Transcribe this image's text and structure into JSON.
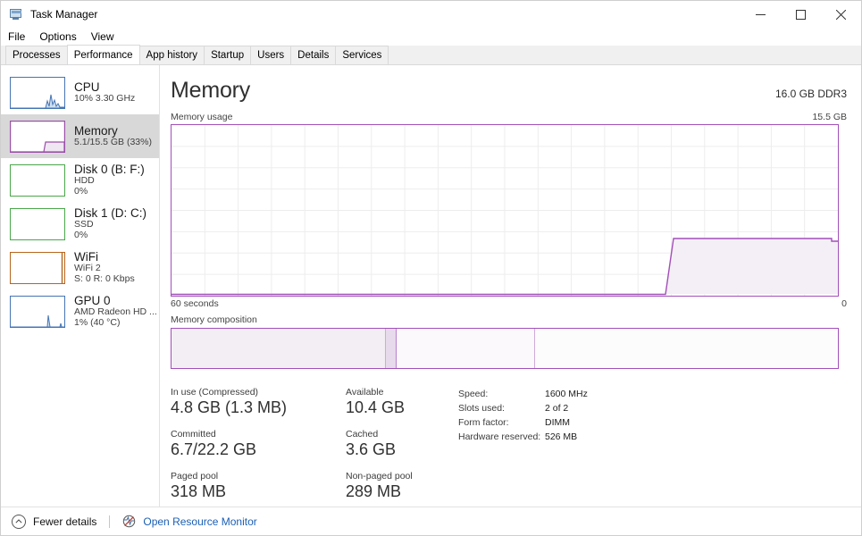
{
  "window": {
    "title": "Task Manager",
    "icon": "task-manager-icon",
    "minimize": "–",
    "maximize": "□",
    "close": "✕"
  },
  "menu": [
    "File",
    "Options",
    "View"
  ],
  "tabs": [
    {
      "label": "Processes",
      "active": false
    },
    {
      "label": "Performance",
      "active": true
    },
    {
      "label": "App history",
      "active": false
    },
    {
      "label": "Startup",
      "active": false
    },
    {
      "label": "Users",
      "active": false
    },
    {
      "label": "Details",
      "active": false
    },
    {
      "label": "Services",
      "active": false
    }
  ],
  "sidebar": {
    "items": [
      {
        "title": "CPU",
        "sub1": "10%  3.30 GHz",
        "sub2": "",
        "color": "#4575b4",
        "selected": false
      },
      {
        "title": "Memory",
        "sub1": "5.1/15.5 GB (33%)",
        "sub2": "",
        "color": "#9a4fa8",
        "selected": true
      },
      {
        "title": "Disk 0 (B: F:)",
        "sub1": "HDD",
        "sub2": "0%",
        "color": "#4aa64a",
        "selected": false
      },
      {
        "title": "Disk 1 (D: C:)",
        "sub1": "SSD",
        "sub2": "0%",
        "color": "#4aa64a",
        "selected": false
      },
      {
        "title": "WiFi",
        "sub1": "WiFi 2",
        "sub2": "S: 0 R: 0 Kbps",
        "color": "#b5651d",
        "selected": false
      },
      {
        "title": "GPU 0",
        "sub1": "AMD Radeon HD ...",
        "sub2": "1%  (40 °C)",
        "color": "#4575b4",
        "selected": false
      }
    ]
  },
  "main": {
    "title": "Memory",
    "capacity": "16.0 GB DDR3",
    "usage_label": "Memory usage",
    "usage_max": "15.5 GB",
    "time_label": "60 seconds",
    "time_zero": "0",
    "composition_label": "Memory composition",
    "accent": "#a24fb8"
  },
  "chart_data": {
    "type": "area",
    "title": "Memory usage",
    "xlabel": "60 seconds",
    "ylabel": "Memory",
    "ylim": [
      0,
      15.5
    ],
    "yunit": "GB",
    "xlim": [
      60,
      0
    ],
    "grid": true,
    "series": [
      {
        "name": "In use",
        "x": [
          60,
          45,
          42.5,
          41,
          12,
          10,
          0
        ],
        "values": [
          0.05,
          0.05,
          0.05,
          5.1,
          5.1,
          5.05,
          5.05
        ]
      }
    ]
  },
  "composition": {
    "segments": [
      {
        "name": "in-use",
        "percent": 32.2,
        "fill": "#f2eef3"
      },
      {
        "name": "modified",
        "percent": 1.6,
        "fill": "#e7daec"
      },
      {
        "name": "standby",
        "percent": 20.8,
        "fill": "#fbf9fc"
      },
      {
        "name": "free",
        "percent": 45.4,
        "fill": "#fdfcfd"
      }
    ]
  },
  "stats": {
    "groups": [
      {
        "label": "In use (Compressed)",
        "value": "4.8 GB (1.3 MB)",
        "col": "left"
      },
      {
        "label": "Available",
        "value": "10.4 GB",
        "col": "mid"
      },
      {
        "label": "Committed",
        "value": "6.7/22.2 GB",
        "col": "left"
      },
      {
        "label": "Cached",
        "value": "3.6 GB",
        "col": "mid"
      },
      {
        "label": "Paged pool",
        "value": "318 MB",
        "col": "left"
      },
      {
        "label": "Non-paged pool",
        "value": "289 MB",
        "col": "mid"
      }
    ],
    "specs": [
      {
        "label": "Speed:",
        "value": "1600 MHz"
      },
      {
        "label": "Slots used:",
        "value": "2 of 2"
      },
      {
        "label": "Form factor:",
        "value": "DIMM"
      },
      {
        "label": "Hardware reserved:",
        "value": "526 MB"
      }
    ]
  },
  "statusbar": {
    "fewer_details": "Fewer details",
    "resource_monitor": "Open Resource Monitor"
  }
}
